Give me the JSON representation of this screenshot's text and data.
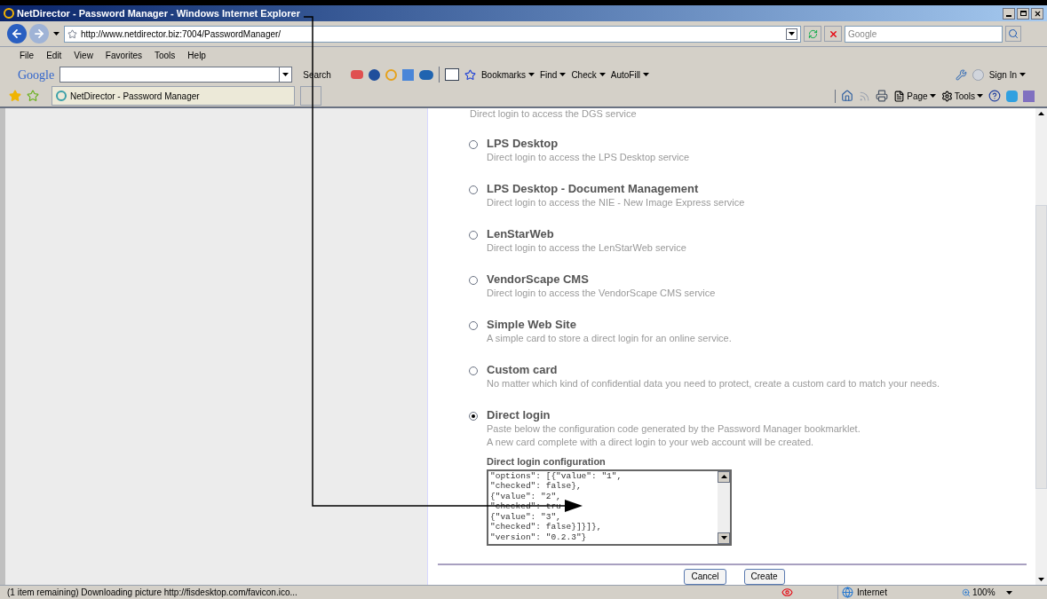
{
  "window": {
    "title": "NetDirector - Password Manager - Windows Internet Explorer"
  },
  "address_bar": {
    "url": "http://www.netdirector.biz:7004/PasswordManager/",
    "search_placeholder": "Google"
  },
  "menu": [
    "File",
    "Edit",
    "View",
    "Favorites",
    "Tools",
    "Help"
  ],
  "google_toolbar": {
    "logo": "Google",
    "search_label": "Search",
    "buttons": [
      "Bookmarks",
      "Find",
      "Check",
      "AutoFill"
    ],
    "sign_in": "Sign In"
  },
  "tab": {
    "title": "NetDirector - Password Manager"
  },
  "command_bar": [
    "Page",
    "Tools"
  ],
  "cut_description": "Direct login to access the DGS service",
  "card_types": [
    {
      "title": "LPS Desktop",
      "description": [
        "Direct login to access the LPS Desktop service"
      ],
      "selected": false
    },
    {
      "title": "LPS Desktop - Document Management",
      "description": [
        "Direct login to access the NIE - New Image Express service"
      ],
      "selected": false
    },
    {
      "title": "LenStarWeb",
      "description": [
        "Direct login to access the LenStarWeb service"
      ],
      "selected": false
    },
    {
      "title": "VendorScape CMS",
      "description": [
        "Direct login to access the VendorScape CMS service"
      ],
      "selected": false
    },
    {
      "title": "Simple Web Site",
      "description": [
        "A simple card to store a direct login for an online service."
      ],
      "selected": false
    },
    {
      "title": "Custom card",
      "description": [
        "No matter which kind of confidential data you need to protect, create a custom card to match your needs."
      ],
      "selected": false
    },
    {
      "title": "Direct login",
      "description": [
        "Paste below the configuration code generated by the Password Manager bookmarklet.",
        "A new card complete with a direct login to your web account will be created."
      ],
      "selected": true
    }
  ],
  "config": {
    "label": "Direct login configuration",
    "lines": [
      "\"options\": [{\"value\": \"1\",",
      "\"checked\": false},",
      "{\"value\": \"2\",",
      "\"checked\": tru",
      "{\"value\": \"3\",",
      "\"checked\": false}]}]},",
      "\"version\": \"0.2.3\"}"
    ]
  },
  "buttons": [
    "Cancel",
    "Create"
  ],
  "status_bar": {
    "text": "(1 item remaining) Downloading picture http://fisdesktop.com/favicon.ico...",
    "zone": "Internet",
    "zoom": "100%"
  }
}
